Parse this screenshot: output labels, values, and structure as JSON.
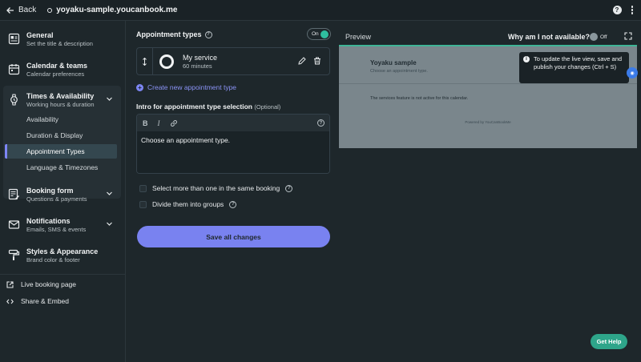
{
  "topbar": {
    "back_label": "Back",
    "site_url": "yoyaku-sample.youcanbook.me"
  },
  "sidebar": {
    "items": [
      {
        "title": "General",
        "subtitle": "Set the title & description",
        "icon": "document-icon"
      },
      {
        "title": "Calendar & teams",
        "subtitle": "Calendar preferences",
        "icon": "calendar-icon"
      },
      {
        "title": "Times & Availability",
        "subtitle": "Working hours & duration",
        "icon": "watch-icon"
      },
      {
        "title": "Booking form",
        "subtitle": "Questions & payments",
        "icon": "form-icon"
      },
      {
        "title": "Notifications",
        "subtitle": "Emails, SMS & events",
        "icon": "mail-icon"
      },
      {
        "title": "Styles & Appearance",
        "subtitle": "Brand color & footer",
        "icon": "paint-roller-icon"
      }
    ],
    "times_subitems": [
      "Availability",
      "Duration & Display",
      "Appointment Types",
      "Language & Timezones"
    ],
    "active_subitem": "Appointment Types",
    "links": [
      {
        "label": "Live booking page",
        "icon": "external-link-icon"
      },
      {
        "label": "Share & Embed",
        "icon": "code-icon"
      }
    ]
  },
  "main": {
    "section_title": "Appointment types",
    "toggle_label": "On",
    "service": {
      "name": "My service",
      "duration": "60 minutes"
    },
    "create_link": "Create new appointment type",
    "intro_title": "Intro for appointment type selection",
    "intro_optional": "(Optional)",
    "editor_text": "Choose an appointment type.",
    "toolbar": {
      "bold": "B",
      "italic": "I"
    },
    "checkbox_1": "Select more than one in the same booking",
    "checkbox_2": "Divide them into groups",
    "save_label": "Save all changes"
  },
  "preview": {
    "label": "Preview",
    "why_label": "Why am I not available?",
    "off_label": "Off",
    "page_title": "Yoyaku sample",
    "page_subtitle": "Choose an appointment type.",
    "notice": "The services feature is not active for this calendar.",
    "powered_by": "Powered by YouCanBookMe",
    "tooltip": "To update the live view, save and publish your changes (Ctrl + S)"
  },
  "get_help": "Get Help",
  "colors": {
    "accent": "#7982f0",
    "toggle_on": "#2fbf9f",
    "get_help": "#2ea58a"
  }
}
